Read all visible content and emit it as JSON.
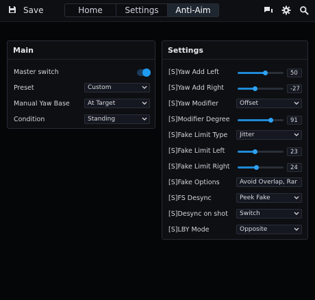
{
  "toolbar": {
    "save_label": "Save",
    "save_icon": "floppy-disk-icon",
    "tabs": [
      {
        "label": "Home",
        "active": false
      },
      {
        "label": "Settings",
        "active": false
      },
      {
        "label": "Anti-Aim",
        "active": true
      }
    ],
    "icons": [
      "chat-icon",
      "gear-icon",
      "search-icon"
    ]
  },
  "main_panel": {
    "title": "Main",
    "master_switch": {
      "label": "Master switch",
      "enabled": true
    },
    "preset": {
      "label": "Preset",
      "value": "Custom"
    },
    "manual_yaw": {
      "label": "Manual Yaw Base",
      "value": "At Target"
    },
    "condition": {
      "label": "Condition",
      "value": "Standing"
    }
  },
  "settings_panel": {
    "title": "Settings",
    "yaw_add_left": {
      "label": "[S]Yaw Add Left",
      "value": "50",
      "fraction": 0.59
    },
    "yaw_add_right": {
      "label": "[S]Yaw Add Right",
      "value": "-27",
      "fraction": 0.38
    },
    "yaw_modifier": {
      "label": "[S]Yaw Modifier",
      "value": "Offset"
    },
    "modifier_degree": {
      "label": "[S]Modifier Degree",
      "value": "91",
      "fraction": 0.72
    },
    "fake_limit_type": {
      "label": "[S]Fake Limit Type",
      "value": "Jitter"
    },
    "fake_limit_left": {
      "label": "[S]Fake Limit Left",
      "value": "23",
      "fraction": 0.38
    },
    "fake_limit_right": {
      "label": "[S]Fake Limit Right",
      "value": "24",
      "fraction": 0.4
    },
    "fake_options": {
      "label": "[S]Fake Options",
      "value": "Avoid Overlap, Ran"
    },
    "fs_desync": {
      "label": "[S]FS Desync",
      "value": "Peek Fake"
    },
    "desync_on_shot": {
      "label": "[S]Desync on shot",
      "value": "Switch"
    },
    "lby_mode": {
      "label": "[S]LBY Mode",
      "value": "Opposite"
    }
  },
  "colors": {
    "accent": "#1e9bf0",
    "background": "#050608",
    "panel": "#0d0f13"
  }
}
